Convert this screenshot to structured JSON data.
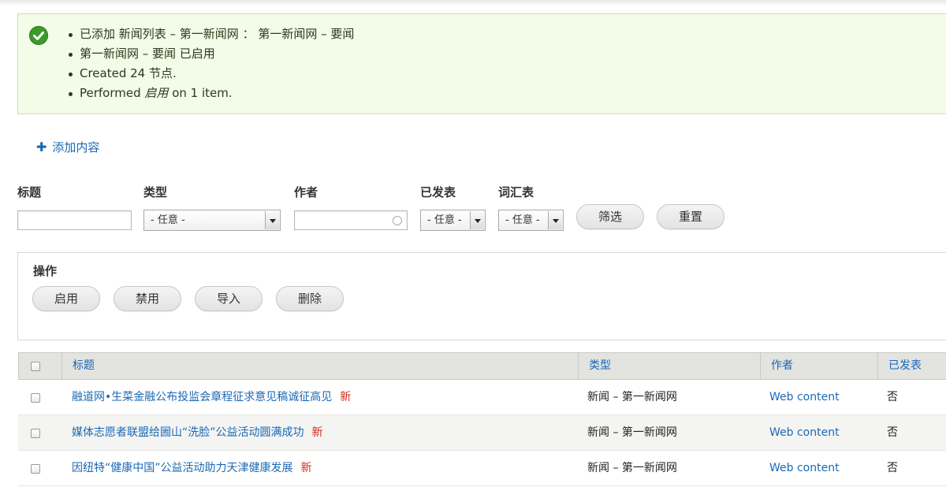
{
  "messages": {
    "items": [
      {
        "text": "已添加 新闻列表 – 第一新闻网 ： 第一新闻网 – 要闻"
      },
      {
        "text": "第一新闻网 – 要闻 已启用"
      },
      {
        "text": "Created 24 节点."
      },
      {
        "before": "Performed ",
        "emph": "启用",
        "after": " on 1 item."
      }
    ],
    "icon": "check-circle-icon",
    "color": "#3b9a2a"
  },
  "add_content": {
    "icon": "plus-icon",
    "label": "添加内容"
  },
  "filters": {
    "title_label": "标题",
    "title_value": "",
    "type_label": "类型",
    "type_value": "- 任意 -",
    "author_label": "作者",
    "author_value": "",
    "published_label": "已发表",
    "published_value": "- 任意 -",
    "vocab_label": "词汇表",
    "vocab_value": "- 任意 -",
    "filter_button": "筛选",
    "reset_button": "重置"
  },
  "operations": {
    "title": "操作",
    "buttons": [
      "启用",
      "禁用",
      "导入",
      "删除"
    ]
  },
  "table": {
    "headers": {
      "title": "标题",
      "type": "类型",
      "author": "作者",
      "published": "已发表"
    },
    "rows": [
      {
        "title": "融道网•生菜金融公布投监会章程征求意见稿诚征高见",
        "new": "新",
        "type": "新闻 – 第一新闻网",
        "author": "Web content",
        "published": "否"
      },
      {
        "title": "媒体志愿者联盟给圌山“洗脸”公益活动圆满成功",
        "new": "新",
        "type": "新闻 – 第一新闻网",
        "author": "Web content",
        "published": "否"
      },
      {
        "title": "因纽特“健康中国”公益活动助力天津健康发展",
        "new": "新",
        "type": "新闻 – 第一新闻网",
        "author": "Web content",
        "published": "否"
      }
    ]
  },
  "colors": {
    "link": "#1a69b5",
    "new": "#d32a1c",
    "status_bg": "#f3fbe9"
  }
}
